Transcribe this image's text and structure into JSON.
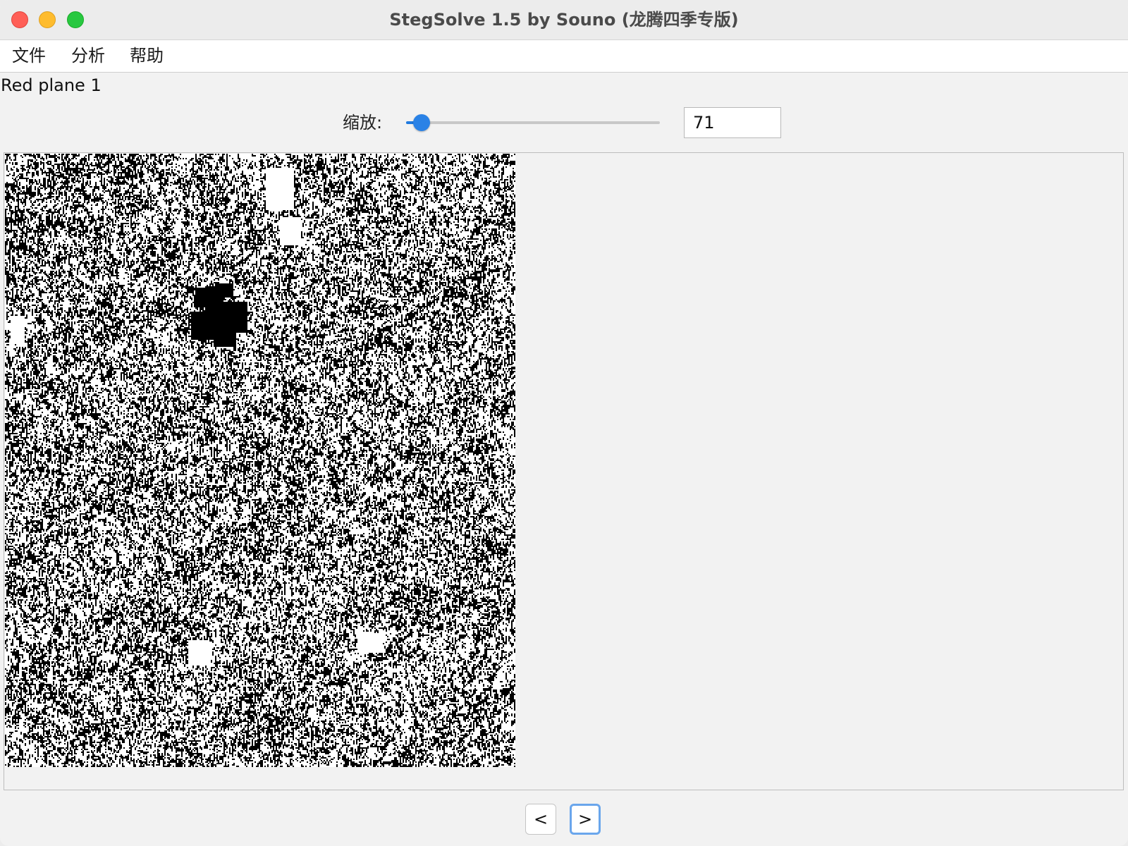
{
  "window": {
    "title": "StegSolve 1.5 by Souno (龙腾四季专版)"
  },
  "menubar": {
    "items": [
      {
        "label": "文件"
      },
      {
        "label": "分析"
      },
      {
        "label": "帮助"
      }
    ]
  },
  "viewer": {
    "plane_label": "Red plane 1"
  },
  "zoom": {
    "label": "缩放:",
    "value": "71",
    "slider_fraction": 0.06
  },
  "navigation": {
    "prev_label": "<",
    "next_label": ">"
  },
  "colors": {
    "accent": "#2a82e6",
    "close": "#ff5f57",
    "minimize": "#febc2e",
    "maximize": "#28c840"
  },
  "icons": {
    "close": "close-icon",
    "minimize": "minimize-icon",
    "maximize": "maximize-icon"
  }
}
